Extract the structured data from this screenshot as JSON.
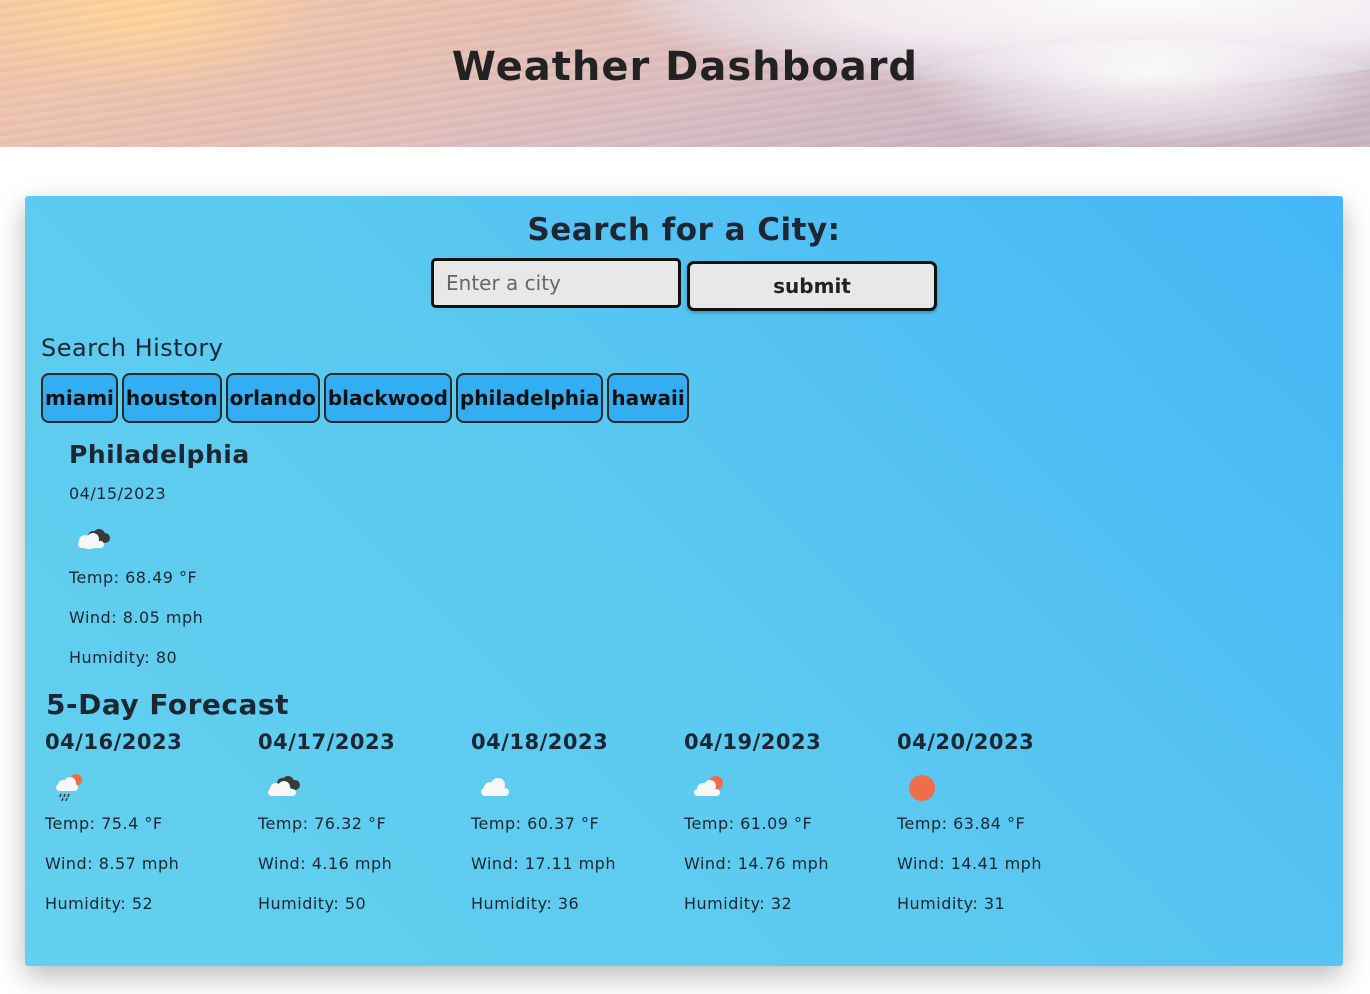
{
  "header": {
    "title": "Weather Dashboard"
  },
  "search": {
    "heading": "Search for a City:",
    "placeholder": "Enter a city",
    "value": "",
    "submit_label": "submit"
  },
  "history": {
    "heading": "Search History",
    "items": [
      {
        "label": "miami"
      },
      {
        "label": "houston"
      },
      {
        "label": "orlando"
      },
      {
        "label": "blackwood"
      },
      {
        "label": "philadelphia"
      },
      {
        "label": "hawaii"
      }
    ]
  },
  "current": {
    "city": "Philadelphia",
    "date": "04/15/2023",
    "icon": "broken-clouds-icon",
    "temp": "Temp: 68.49 °F",
    "wind": "Wind: 8.05 mph",
    "humidity": "Humidity: 80"
  },
  "forecast": {
    "heading": "5-Day Forecast",
    "days": [
      {
        "date": "04/16/2023",
        "icon": "rain-icon",
        "temp": "Temp: 75.4 °F",
        "wind": "Wind: 8.57 mph",
        "humidity": "Humidity: 52"
      },
      {
        "date": "04/17/2023",
        "icon": "broken-clouds-icon",
        "temp": "Temp: 76.32 °F",
        "wind": "Wind: 4.16 mph",
        "humidity": "Humidity: 50"
      },
      {
        "date": "04/18/2023",
        "icon": "cloud-icon",
        "temp": "Temp: 60.37 °F",
        "wind": "Wind: 17.11 mph",
        "humidity": "Humidity: 36"
      },
      {
        "date": "04/19/2023",
        "icon": "few-clouds-icon",
        "temp": "Temp: 61.09 °F",
        "wind": "Wind: 14.76 mph",
        "humidity": "Humidity: 32"
      },
      {
        "date": "04/20/2023",
        "icon": "sun-icon",
        "temp": "Temp: 63.84 °F",
        "wind": "Wind: 14.41 mph",
        "humidity": "Humidity: 31"
      }
    ]
  },
  "colors": {
    "panel_start": "#63d0ee",
    "panel_end": "#45b6f6",
    "history_button": "#34aef2",
    "sun": "#ee6e4c"
  }
}
